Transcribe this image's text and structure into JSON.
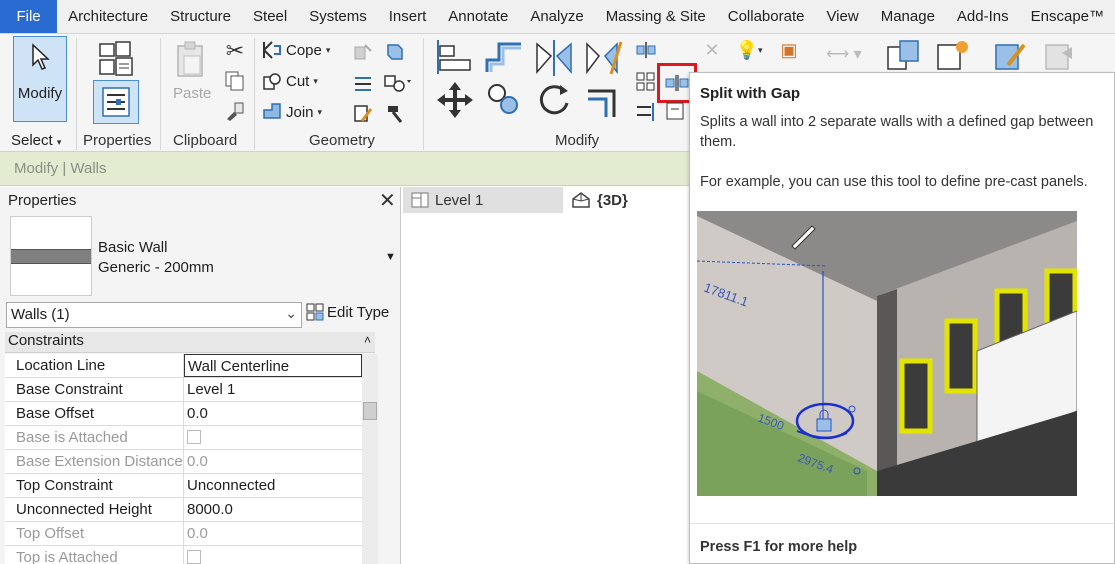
{
  "menu": {
    "file": "File",
    "items": [
      "Architecture",
      "Structure",
      "Steel",
      "Systems",
      "Insert",
      "Annotate",
      "Analyze",
      "Massing & Site",
      "Collaborate",
      "View",
      "Manage",
      "Add-Ins",
      "Enscape™"
    ],
    "active": "Modify"
  },
  "ribbon": {
    "select_panel": {
      "modify_label": "Modify",
      "select_label": "Select",
      "caret": "▾"
    },
    "properties_panel": {
      "label": "Properties"
    },
    "clipboard_panel": {
      "paste_label": "Paste",
      "label": "Clipboard"
    },
    "geometry_panel": {
      "cope_label": "Cope",
      "cut_label": "Cut",
      "join_label": "Join",
      "label": "Geometry"
    },
    "modify_panel": {
      "label": "Modify"
    }
  },
  "context_bar": {
    "text": "Modify | Walls"
  },
  "properties": {
    "title": "Properties",
    "close": "✕",
    "type_family": "Basic Wall",
    "type_name": "Generic - 200mm",
    "type_dropdown": "▼",
    "filter_value": "Walls (1)",
    "filter_caret": "⌵",
    "edit_type_label": "Edit Type",
    "group_label": "Constraints",
    "group_collapse": "˄",
    "rows": [
      {
        "name": "Location Line",
        "value": "Wall Centerline",
        "state": "edit"
      },
      {
        "name": "Base Constraint",
        "value": "Level 1",
        "state": "normal"
      },
      {
        "name": "Base Offset",
        "value": "0.0",
        "state": "normal"
      },
      {
        "name": "Base is Attached",
        "value": "",
        "state": "dim",
        "checkbox": true
      },
      {
        "name": "Base Extension Distance",
        "value": "0.0",
        "state": "dim"
      },
      {
        "name": "Top Constraint",
        "value": "Unconnected",
        "state": "normal"
      },
      {
        "name": "Unconnected Height",
        "value": "8000.0",
        "state": "normal"
      },
      {
        "name": "Top Offset",
        "value": "0.0",
        "state": "dim"
      },
      {
        "name": "Top is Attached",
        "value": "",
        "state": "dim",
        "checkbox": true
      }
    ]
  },
  "view_tabs": [
    {
      "label": "Level 1",
      "active": false
    },
    {
      "label": "{3D}",
      "active": true
    }
  ],
  "tooltip": {
    "title": "Split with Gap",
    "description": "Splits a wall into 2 separate walls with a defined gap between them.",
    "example": "For example, you can use this tool to define pre-cast panels.",
    "image_dimension_1": "17811.1",
    "image_dimension_2": "1500",
    "image_dimension_3": "2975.4",
    "footer": "Press F1 for more help"
  },
  "colors": {
    "file_tab": "#2a6bd1",
    "context_bar": "#e3ecd0",
    "highlight": "#e0171c",
    "accent_blue": "#2e6bc4"
  }
}
